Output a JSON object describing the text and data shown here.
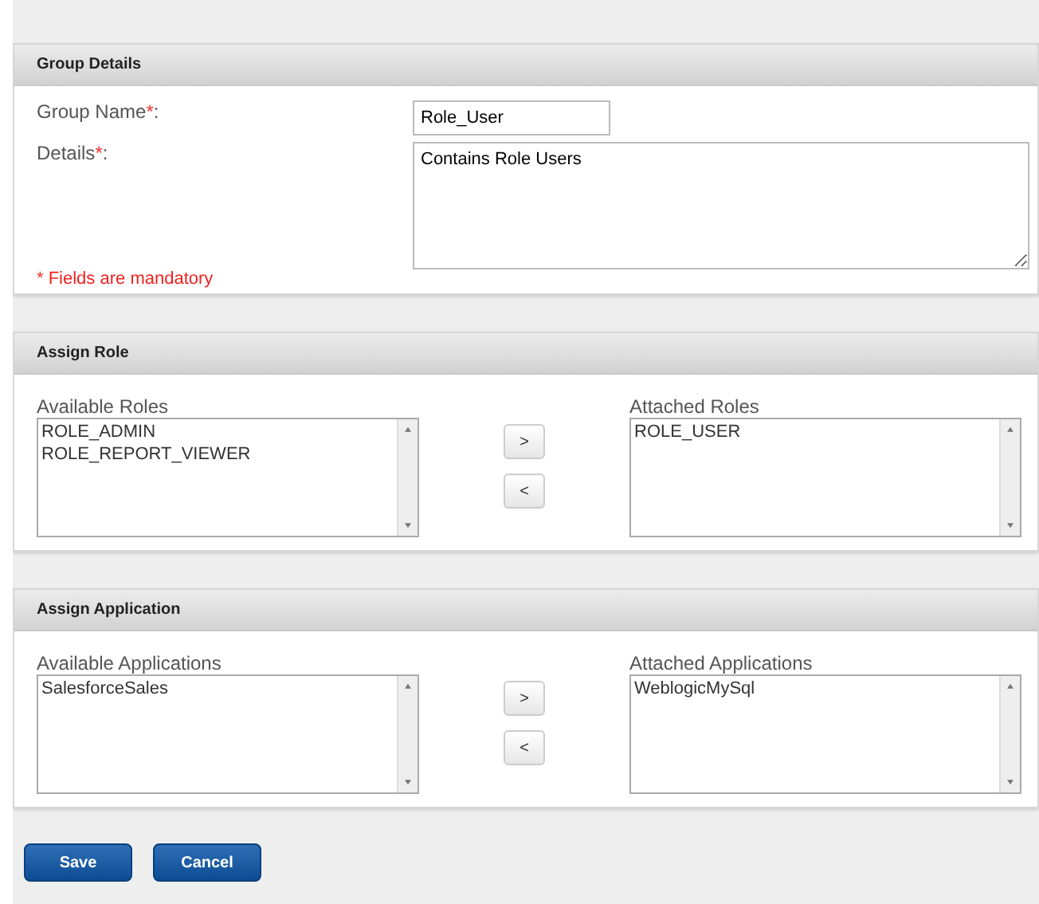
{
  "sections": [
    {
      "kind": "form",
      "title": "Group Details",
      "fields": [
        {
          "kind": "text",
          "label": "Group Name",
          "mark": "*",
          "suffix": ":",
          "value": "Role_User"
        },
        {
          "kind": "textarea",
          "label": "Details",
          "mark": "*",
          "suffix": ":",
          "value": "Contains Role Users"
        }
      ],
      "note": {
        "mark": "*",
        "text": "Fields are mandatory"
      }
    },
    {
      "kind": "transfer",
      "title": "Assign Role",
      "left": {
        "label": "Available Roles",
        "items": [
          "ROLE_ADMIN",
          "ROLE_REPORT_VIEWER"
        ]
      },
      "buttons": [
        ">",
        "<"
      ],
      "right": {
        "label": "Attached Roles",
        "items": [
          "ROLE_USER"
        ]
      }
    },
    {
      "kind": "transfer",
      "title": "Assign Application",
      "left": {
        "label": "Available Applications",
        "items": [
          "SalesforceSales"
        ]
      },
      "buttons": [
        ">",
        "<"
      ],
      "right": {
        "label": "Attached Applications",
        "items": [
          "WeblogicMySql"
        ]
      }
    }
  ],
  "actions": [
    "Save",
    "Cancel"
  ]
}
